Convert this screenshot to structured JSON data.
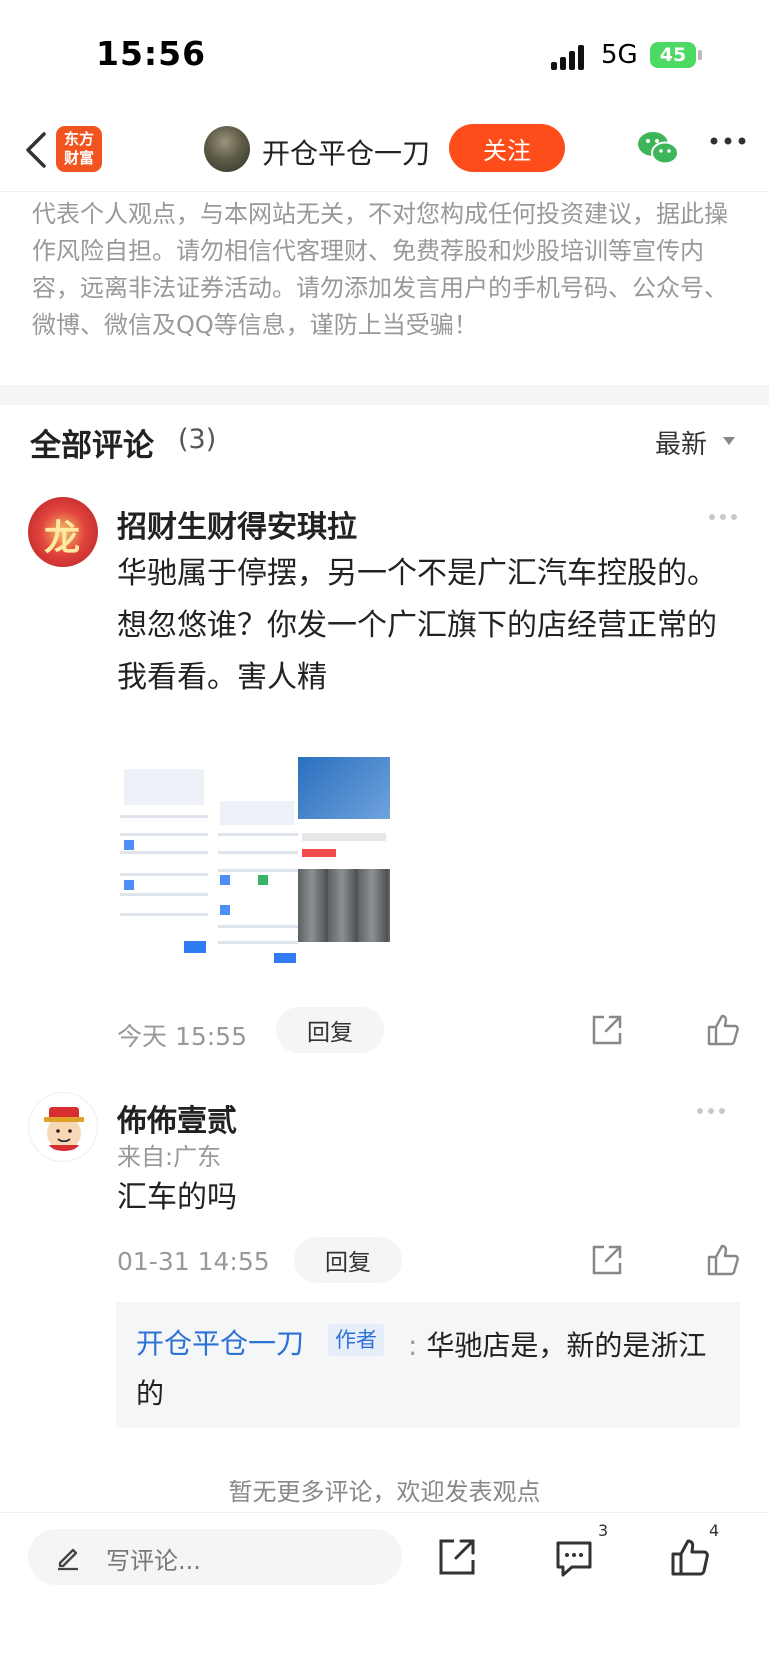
{
  "status": {
    "time": "15:56",
    "network": "5G",
    "battery": "45"
  },
  "nav": {
    "logo_line1": "东方",
    "logo_line2": "财富",
    "username": "开仓平仓一刀",
    "follow_label": "关注"
  },
  "disclaimer": "代表个人观点，与本网站无关，不对您构成任何投资建议，据此操作风险自担。请勿相信代客理财、免费荐股和炒股培训等宣传内容，远离非法证券活动。请勿添加发言用户的手机号码、公众号、微博、微信及QQ等信息，谨防上当受骗！",
  "comments_section": {
    "title": "全部评论",
    "count": "(3)",
    "sort_label": "最新"
  },
  "comments": [
    {
      "name": "招财生财得安琪拉",
      "text": "华驰属于停摆，另一个不是广汇汽车控股的。想忽悠谁？你发一个广汇旗下的店经营正常的我看看。害人精",
      "time": "今天 15:55",
      "reply_label": "回复"
    },
    {
      "name": "佈佈壹贰",
      "location": "来自:广东",
      "text": "汇车的吗",
      "time": "01-31 14:55",
      "reply_label": "回复",
      "replies": [
        {
          "author": "开仓平仓一刀",
          "badge": "作者",
          "separator": ":",
          "text": "华驰店是，新的是浙江的"
        }
      ]
    }
  ],
  "no_more_text": "暂无更多评论，欢迎发表观点",
  "bottom": {
    "input_placeholder": "写评论...",
    "comment_count": "3",
    "like_count": "4"
  }
}
